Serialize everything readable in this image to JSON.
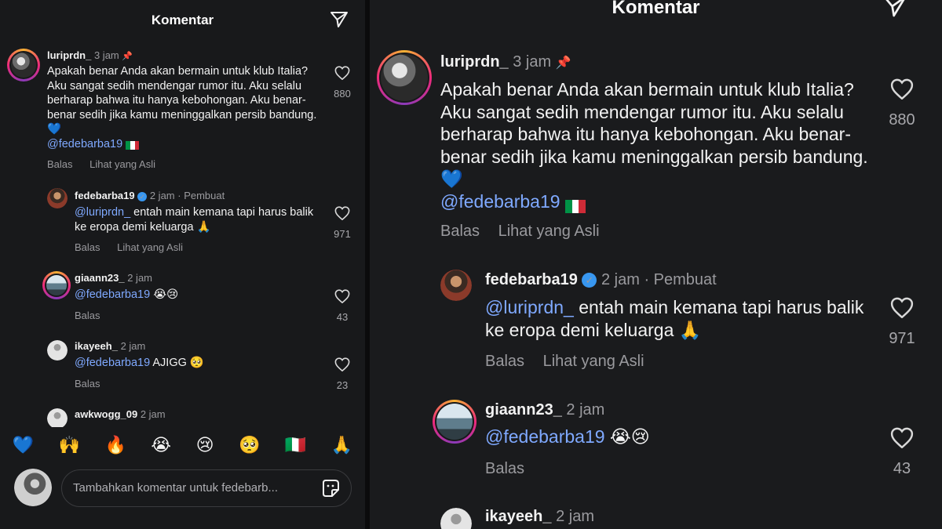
{
  "header": {
    "title": "Komentar"
  },
  "comments": [
    {
      "username": "luriprdn_",
      "time": "3 jam",
      "text": "Apakah benar Anda akan bermain untuk klub Italia? Aku sangat sedih mendengar rumor itu. Aku selalu berharap bahwa itu hanya kebohongan. Aku benar-benar sedih jika kamu meninggalkan persib bandung. 💙",
      "mention": "@fedebarba19",
      "likes": "880",
      "reply_label": "Balas",
      "original_label": "Lihat yang Asli"
    },
    {
      "username": "fedebarba19",
      "time": "2 jam",
      "creator_label": "· Pembuat",
      "mention": "@luriprdn_",
      "text": "entah main kemana tapi harus balik ke eropa demi keluarga 🙏",
      "likes": "971",
      "reply_label": "Balas",
      "original_label": "Lihat yang Asli"
    },
    {
      "username": "giaann23_",
      "time": "2 jam",
      "mention": "@fedebarba19",
      "text": "😭😢",
      "likes": "43",
      "reply_label": "Balas"
    },
    {
      "username": "ikayeeh_",
      "time": "2 jam",
      "mention": "@fedebarba19",
      "text": "AJIGG 🥺",
      "likes": "23",
      "reply_label": "Balas"
    },
    {
      "username": "awkwogg_09",
      "time": "2 jam"
    }
  ],
  "emoji_bar": [
    "💙",
    "🙌",
    "🔥",
    "😭",
    "😢",
    "🥺",
    "🇮🇹",
    "🙏"
  ],
  "composer": {
    "placeholder": "Tambahkan komentar untuk fedebarb..."
  },
  "icons": {
    "send": "send-icon",
    "heart": "heart-icon",
    "pin": "pin-icon",
    "verified": "verified-badge-icon",
    "sticker": "sticker-icon"
  },
  "colors": {
    "background": "#18191b",
    "mention": "#7fa9ff",
    "muted": "#9a9a9e",
    "verified": "#3897f0"
  }
}
